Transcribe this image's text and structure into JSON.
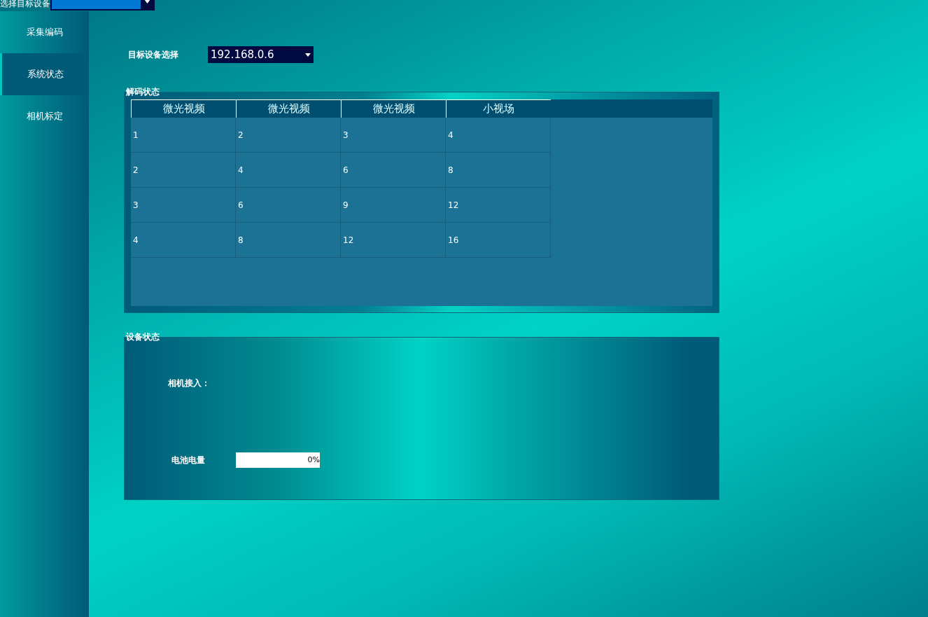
{
  "top_bar": {
    "label": "选择目标设备"
  },
  "sidebar": {
    "items": [
      {
        "label": "采集编码",
        "selected": false
      },
      {
        "label": "系统状态",
        "selected": true
      },
      {
        "label": "相机标定",
        "selected": false
      }
    ]
  },
  "target": {
    "label": "目标设备选择",
    "combo": {
      "value": "192.168.0.6"
    }
  },
  "decode_group": {
    "title": "解码状态",
    "table": {
      "columns": [
        "微光视频",
        "微光视频",
        "微光视频",
        "小视场"
      ],
      "rows": [
        [
          "1",
          "2",
          "3",
          "4"
        ],
        [
          "2",
          "4",
          "6",
          "8"
        ],
        [
          "3",
          "6",
          "9",
          "12"
        ],
        [
          "4",
          "8",
          "12",
          "16"
        ]
      ]
    }
  },
  "device_group": {
    "title": "设备状态",
    "camera_label": "相机接入：",
    "battery": {
      "label": "电池电量",
      "level": 0,
      "reading": "0%"
    }
  }
}
